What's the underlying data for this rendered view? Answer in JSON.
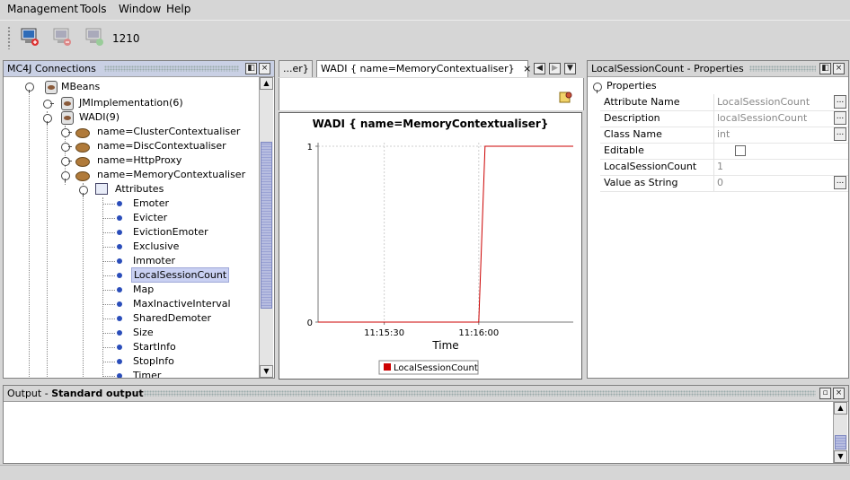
{
  "menu": {
    "management": "Management",
    "tools": "Tools",
    "window": "Window",
    "help": "Help"
  },
  "toolbar": {
    "connect_icon": "monitor-add-icon",
    "disconnect_icon": "monitor-remove-icon",
    "refresh_icon": "monitor-refresh-icon",
    "port_label": "1210"
  },
  "connections": {
    "title": "MC4J Connections",
    "mbeans": "MBeans",
    "jmi": "JMImplementation(6)",
    "wadi": "WADI(9)",
    "beans": [
      "name=ClusterContextualiser",
      "name=DiscContextualiser",
      "name=HttpProxy",
      "name=MemoryContextualiser"
    ],
    "attributes_label": "Attributes",
    "attributes": [
      "Emoter",
      "Evicter",
      "EvictionEmoter",
      "Exclusive",
      "Immoter",
      "LocalSessionCount",
      "Map",
      "MaxInactiveInterval",
      "SharedDemoter",
      "Size",
      "StartInfo",
      "StopInfo",
      "Timer"
    ],
    "selected_attribute": "LocalSessionCount"
  },
  "editor": {
    "tab_prev": "...er}",
    "tab_active": "WADI { name=MemoryContextualiser}",
    "close_glyph": "×"
  },
  "chart_data": {
    "type": "line",
    "title": "WADI { name=MemoryContextualiser}",
    "xlabel": "Time",
    "ylabel": "",
    "x_ticks": [
      "11:15:30",
      "11:16:00"
    ],
    "y_ticks": [
      "0",
      "1"
    ],
    "ylim": [
      0,
      1
    ],
    "grid": true,
    "legend_position": "bottom",
    "series": [
      {
        "name": "LocalSessionCount",
        "color": "#cc0000",
        "points": [
          {
            "x": "11:15:09",
            "y": 0
          },
          {
            "x": "11:16:00",
            "y": 0
          },
          {
            "x": "11:16:02",
            "y": 1
          },
          {
            "x": "11:16:30",
            "y": 1
          }
        ]
      }
    ]
  },
  "properties": {
    "title": "LocalSessionCount - Properties",
    "section": "Properties",
    "rows": [
      {
        "key": "Attribute Name",
        "value": "LocalSessionCount",
        "ellipsis": "..."
      },
      {
        "key": "Description",
        "value": "localSessionCount",
        "ellipsis": "..."
      },
      {
        "key": "Class Name",
        "value": "int",
        "ellipsis": "..."
      },
      {
        "key": "Editable",
        "value": ""
      },
      {
        "key": "LocalSessionCount",
        "value": "1"
      },
      {
        "key": "Value as String",
        "value": "0",
        "ellipsis": "..."
      }
    ]
  },
  "output": {
    "title_prefix": "Output - ",
    "title_bold": "Standard output"
  },
  "window_buttons": {
    "restore": "◧",
    "close": "×",
    "minimize": "▫"
  },
  "colors": {
    "selection": "#c9d0f2",
    "active_title": "#c9d0e4",
    "series": "#cc0000"
  }
}
